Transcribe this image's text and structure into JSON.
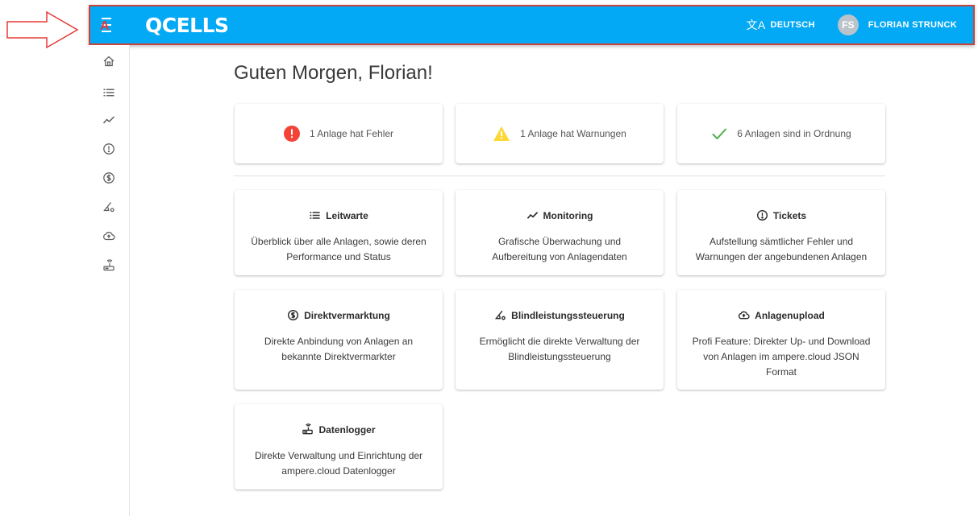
{
  "annotation": {
    "label": "A"
  },
  "header": {
    "logo": "QCELLS",
    "language": "DEUTSCH",
    "avatar_initials": "FS",
    "user_name": "FLORIAN STRUNCK",
    "color": "#03a9f4"
  },
  "sidenav": {
    "items": [
      {
        "name": "home",
        "icon": "home-icon"
      },
      {
        "name": "leitwarte",
        "icon": "list-icon"
      },
      {
        "name": "monitoring",
        "icon": "trend-icon"
      },
      {
        "name": "tickets",
        "icon": "alert-circle-icon"
      },
      {
        "name": "direktvermarktung",
        "icon": "dollar-circle-icon"
      },
      {
        "name": "blindleistung",
        "icon": "angle-gear-icon"
      },
      {
        "name": "upload",
        "icon": "cloud-upload-icon"
      },
      {
        "name": "datenlogger",
        "icon": "router-icon"
      }
    ]
  },
  "main": {
    "greeting": "Guten Morgen, Florian!",
    "status": [
      {
        "text": "1 Anlage hat Fehler",
        "color": "#f44336"
      },
      {
        "text": "1 Anlage hat Warnungen",
        "color": "#fdd835"
      },
      {
        "text": "6 Anlagen sind in Ordnung",
        "color": "#4caf50"
      }
    ],
    "features": [
      {
        "title": "Leitwarte",
        "description": "Überblick über alle Anlagen, sowie deren Performance und Status",
        "icon": "list-icon"
      },
      {
        "title": "Monitoring",
        "description": "Grafische Überwachung und Aufbereitung von Anlagendaten",
        "icon": "trend-icon"
      },
      {
        "title": "Tickets",
        "description": "Aufstellung sämtlicher Fehler und Warnungen der angebundenen Anlagen",
        "icon": "alert-circle-icon"
      },
      {
        "title": "Direktvermarktung",
        "description": "Direkte Anbindung von Anlagen an bekannte Direktvermarkter",
        "icon": "dollar-circle-icon"
      },
      {
        "title": "Blindleistungssteuerung",
        "description": "Ermöglicht die direkte Verwaltung der Blindleistungssteuerung",
        "icon": "angle-gear-icon"
      },
      {
        "title": "Anlagenupload",
        "description": "Profi Feature: Direkter Up- und Download von Anlagen im ampere.cloud JSON Format",
        "icon": "cloud-upload-icon"
      },
      {
        "title": "Datenlogger",
        "description": "Direkte Verwaltung und Einrichtung der ampere.cloud Datenlogger",
        "icon": "router-icon"
      }
    ]
  }
}
